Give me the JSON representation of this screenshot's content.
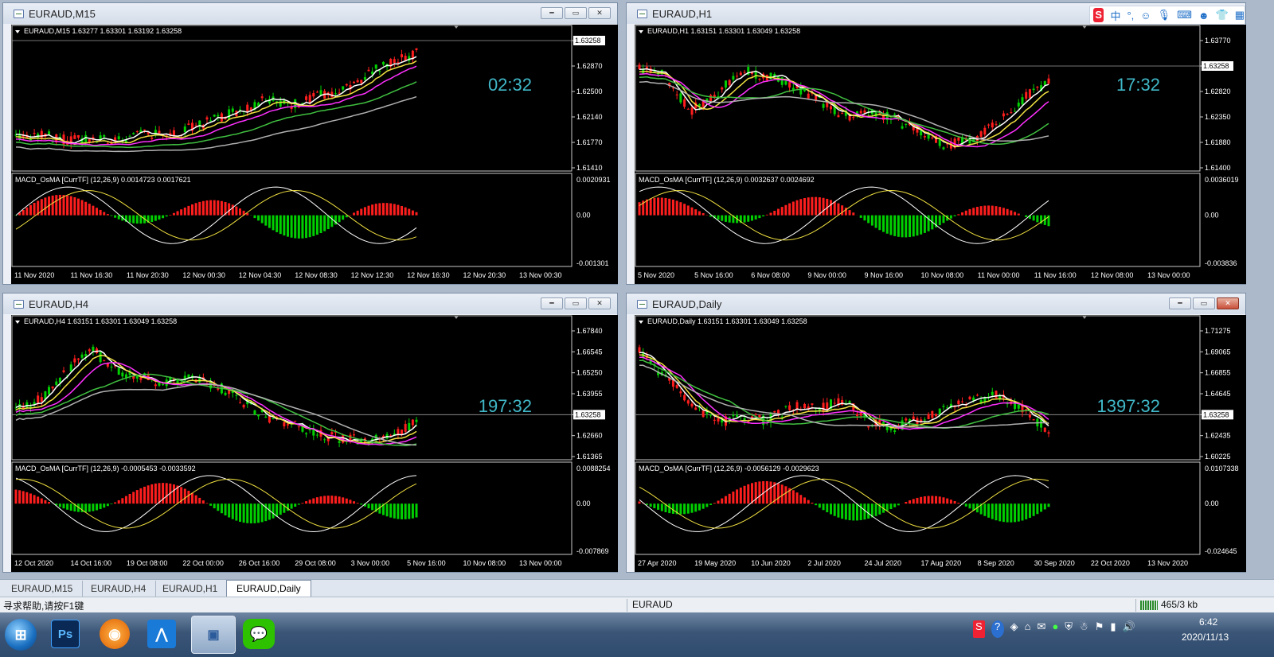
{
  "windows": [
    {
      "id": "m15",
      "title": "EURAUD,M15",
      "header": "EURAUD,M15  1.63277 1.63301 1.63192 1.63258",
      "timer": "02:32",
      "price_label": "1.63258",
      "y_ticks": [
        "1.63258",
        "1.62870",
        "1.62500",
        "1.62140",
        "1.61770",
        "1.61410"
      ],
      "macd_label": "MACD_OsMA [CurrTF] (12,26,9) 0.0014723 0.0017621",
      "macd_ticks": [
        "0.0020931",
        "0.00",
        "-0.001301"
      ],
      "x_ticks": [
        "11 Nov 2020",
        "11 Nov 16:30",
        "11 Nov 20:30",
        "12 Nov 00:30",
        "12 Nov 04:30",
        "12 Nov 08:30",
        "12 Nov 12:30",
        "12 Nov 16:30",
        "12 Nov 20:30",
        "13 Nov 00:30"
      ]
    },
    {
      "id": "h1",
      "title": "EURAUD,H1",
      "header": "EURAUD,H1  1.63151 1.63301 1.63049 1.63258",
      "timer": "17:32",
      "price_label": "1.63258",
      "y_ticks": [
        "1.63770",
        "1.63258",
        "1.62820",
        "1.62350",
        "1.61880",
        "1.61400"
      ],
      "macd_label": "MACD_OsMA [CurrTF] (12,26,9) 0.0032637 0.0024692",
      "macd_ticks": [
        "0.0036019",
        "0.00",
        "-0.003836"
      ],
      "x_ticks": [
        "5 Nov 2020",
        "5 Nov 16:00",
        "6 Nov 08:00",
        "9 Nov 00:00",
        "9 Nov 16:00",
        "10 Nov 08:00",
        "11 Nov 00:00",
        "11 Nov 16:00",
        "12 Nov 08:00",
        "13 Nov 00:00"
      ]
    },
    {
      "id": "h4",
      "title": "EURAUD,H4",
      "header": "EURAUD,H4  1.63151 1.63301 1.63049 1.63258",
      "timer": "197:32",
      "price_label": "1.63258",
      "y_ticks": [
        "1.67840",
        "1.66545",
        "1.65250",
        "1.63955",
        "1.63258",
        "1.62660",
        "1.61365"
      ],
      "macd_label": "MACD_OsMA [CurrTF] (12,26,9) -0.0005453 -0.0033592",
      "macd_ticks": [
        "0.0088254",
        "0.00",
        "-0.007869"
      ],
      "x_ticks": [
        "12 Oct 2020",
        "14 Oct 16:00",
        "19 Oct 08:00",
        "22 Oct 00:00",
        "26 Oct 16:00",
        "29 Oct 08:00",
        "3 Nov 00:00",
        "5 Nov 16:00",
        "10 Nov 08:00",
        "13 Nov 00:00"
      ]
    },
    {
      "id": "daily",
      "title": "EURAUD,Daily",
      "header": "EURAUD,Daily  1.63151 1.63301 1.63049 1.63258",
      "timer": "1397:32",
      "price_label": "1.63258",
      "y_ticks": [
        "1.71275",
        "1.69065",
        "1.66855",
        "1.64645",
        "1.63258",
        "1.62435",
        "1.60225"
      ],
      "macd_label": "MACD_OsMA [CurrTF] (12,26,9) -0.0056129 -0.0029623",
      "macd_ticks": [
        "0.0107338",
        "0.00",
        "-0.024645"
      ],
      "x_ticks": [
        "27 Apr 2020",
        "19 May 2020",
        "10 Jun 2020",
        "2 Jul 2020",
        "24 Jul 2020",
        "17 Aug 2020",
        "8 Sep 2020",
        "30 Sep 2020",
        "22 Oct 2020",
        "13 Nov 2020"
      ]
    }
  ],
  "tabs": [
    "EURAUD,M15",
    "EURAUD,H4",
    "EURAUD,H1",
    "EURAUD,Daily"
  ],
  "status": {
    "help": "寻求帮助,请按F1键",
    "symbol": "EURAUD",
    "traffic": "465/3 kb"
  },
  "taskbar": {
    "time": "6:42",
    "date": "2020/11/13",
    "apps": [
      "start-orb",
      "photoshop",
      "browser",
      "app-blue",
      "metatrader",
      "wechat"
    ]
  },
  "ime": {
    "lang": "中",
    "punct": "°,"
  },
  "colors": {
    "bull": "#00d000",
    "bear": "#ff1e1e",
    "ma_fast": "#ffffff",
    "ma_yellow": "#f0e040",
    "ma_magenta": "#ff30ff",
    "ma_green": "#40c040",
    "ma_gray": "#b0b0b0",
    "timer": "#40b8c8"
  }
}
